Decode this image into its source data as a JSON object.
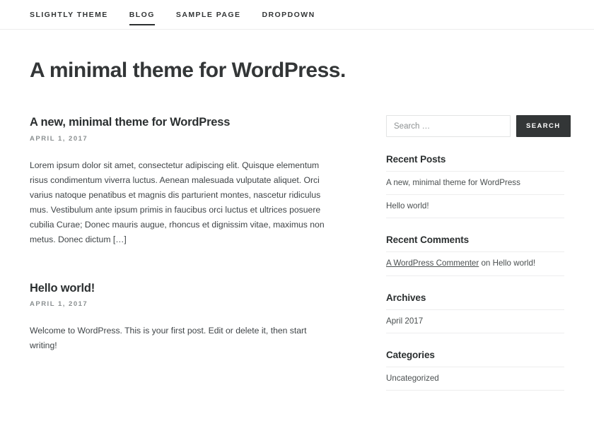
{
  "header": {
    "nav": [
      {
        "label": "Slightly Theme",
        "active": false
      },
      {
        "label": "Blog",
        "active": true
      },
      {
        "label": "Sample Page",
        "active": false
      },
      {
        "label": "Dropdown",
        "active": false
      }
    ]
  },
  "site": {
    "title": "A minimal theme for WordPress."
  },
  "posts": [
    {
      "title": "A new, minimal theme for WordPress",
      "date": "April 1, 2017",
      "body": "Lorem ipsum dolor sit amet, consectetur adipiscing elit. Quisque elementum risus condimentum viverra luctus. Aenean malesuada vulputate aliquet. Orci varius natoque penatibus et magnis dis parturient montes, nascetur ridiculus mus. Vestibulum ante ipsum primis in faucibus orci luctus et ultrices posuere cubilia Curae; Donec mauris augue, rhoncus et dignissim vitae, maximus non metus. Donec dictum […]"
    },
    {
      "title": "Hello world!",
      "date": "April 1, 2017",
      "body": "Welcome to WordPress. This is your first post. Edit or delete it, then start writing!"
    }
  ],
  "sidebar": {
    "search": {
      "placeholder": "Search …",
      "value": "",
      "button_label": "Search"
    },
    "recent_posts": {
      "title": "Recent Posts",
      "items": [
        "A new, minimal theme for WordPress",
        "Hello world!"
      ]
    },
    "recent_comments": {
      "title": "Recent Comments",
      "items": [
        {
          "author": "A WordPress Commenter",
          "connector": " on ",
          "target": "Hello world!"
        }
      ]
    },
    "archives": {
      "title": "Archives",
      "items": [
        "April 2017"
      ]
    },
    "categories": {
      "title": "Categories",
      "items": [
        "Uncategorized"
      ]
    }
  },
  "colors": {
    "text": "#333637",
    "muted": "#8a8f90",
    "button_bg": "#333637",
    "border": "#ededee"
  }
}
